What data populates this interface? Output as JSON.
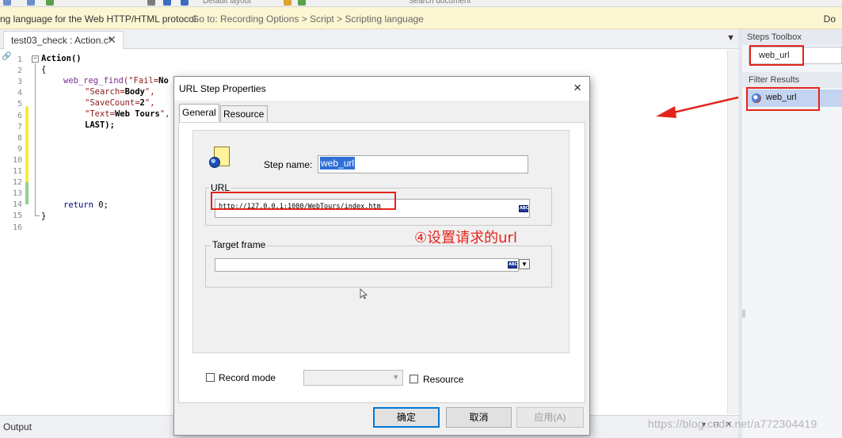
{
  "toolbar": {
    "layout_label": "Default layout",
    "search_label": "Search document"
  },
  "infobar": {
    "message": "ng language for the Web HTTP/HTML protocol.",
    "goto": "Go to: Recording Options > Script > Scripting language",
    "right": "Do"
  },
  "editor": {
    "tab_label": "test03_check : Action.c*",
    "line_numbers": [
      "1",
      "2",
      "3",
      "4",
      "5",
      "6",
      "7",
      "8",
      "9",
      "10",
      "11",
      "12",
      "13",
      "14",
      "15",
      "16"
    ],
    "code": {
      "l1_fn": "Action",
      "l1_rest": "()",
      "l2": "{",
      "l3_fn": "web_reg_find",
      "l3_open": "(\"Fail=",
      "l3_bold": "No",
      "l4_a": "\"Search=",
      "l4_b": "Body",
      "l4_c": "\",",
      "l5_a": "\"SaveCount=",
      "l5_b": "2",
      "l5_c": "\",",
      "l6_a": "\"Text=",
      "l6_b": "Web Tours",
      "l6_c": "\",",
      "l7": "LAST);",
      "l14_kw": "return",
      "l14_rest": " 0;",
      "l15": "}"
    }
  },
  "right_panel": {
    "title": "Steps Toolbox",
    "search_value": "web_url",
    "filter_title": "Filter Results",
    "result_item": "web_url"
  },
  "output": {
    "label": "Output"
  },
  "watermark": "https://blog.csdn.net/a772304419",
  "dialog": {
    "title": "URL Step Properties",
    "close": "×",
    "tabs": [
      "General",
      "Resource"
    ],
    "step_name_label": "Step name:",
    "step_name_value": "web_url",
    "url_group_label": "URL",
    "url_value": "http://127.0.0.1:1080/WebTours/index.htm",
    "abc_text": "ABC",
    "target_frame_label": "Target frame",
    "target_frame_value": "",
    "record_mode_label": "Record mode",
    "resource_label": "Resource",
    "annotation": "④设置请求的url",
    "buttons": {
      "ok": "确定",
      "cancel": "取消",
      "apply": "应用(A)"
    }
  },
  "colors": {
    "annotation_red": "#e3241b",
    "selection_blue": "#2e6fd6",
    "infobar_bg": "#fdf6d3"
  }
}
